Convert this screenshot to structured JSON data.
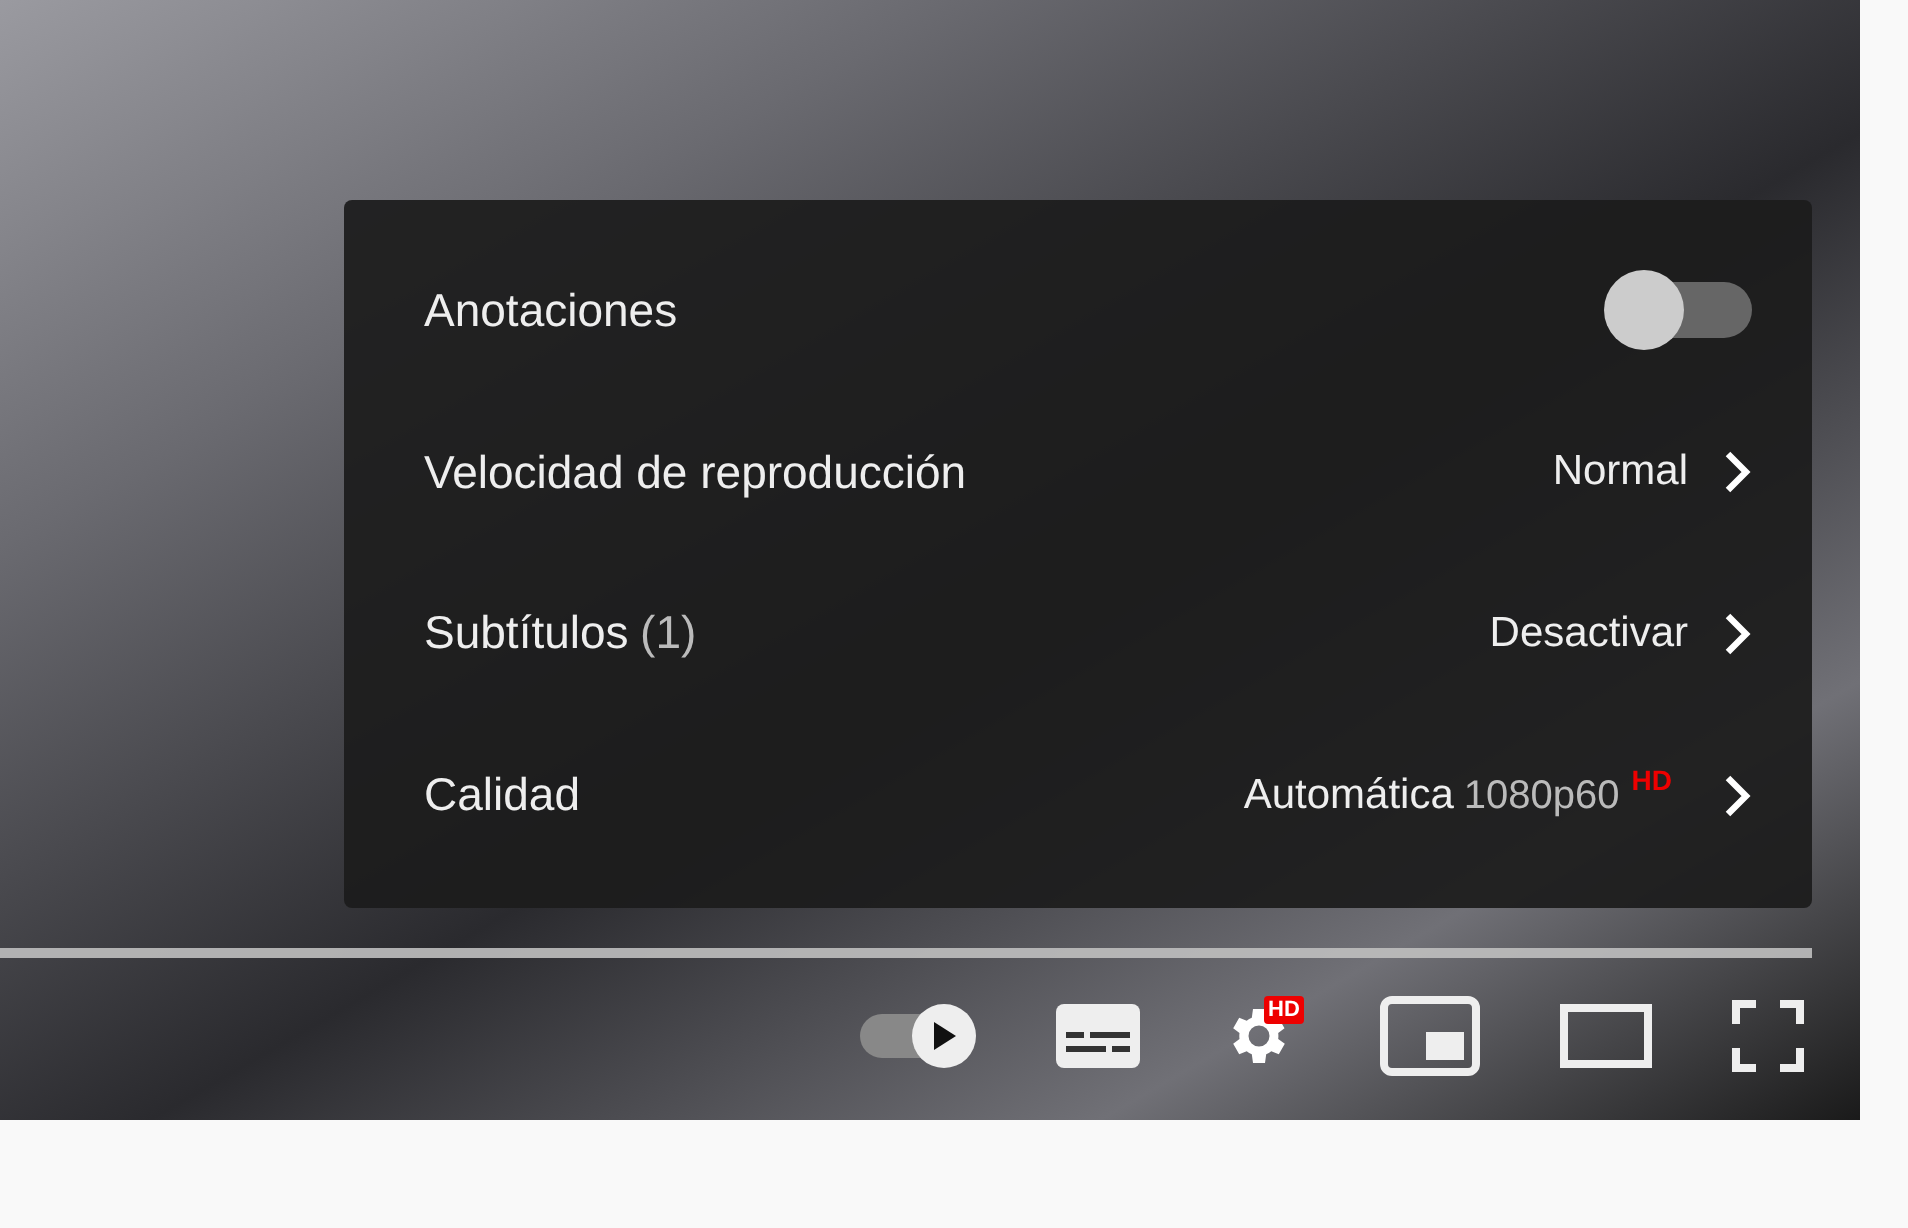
{
  "settings_menu": {
    "items": [
      {
        "kind": "toggle",
        "label": "Anotaciones",
        "on": false
      },
      {
        "kind": "submenu",
        "label": "Velocidad de reproducción",
        "value": "Normal"
      },
      {
        "kind": "submenu",
        "label": "Subtítulos",
        "count": "(1)",
        "value": "Desactivar"
      },
      {
        "kind": "submenu",
        "label": "Calidad",
        "value": "Automática",
        "detail": "1080p60",
        "badge": "HD"
      }
    ]
  },
  "player_controls": {
    "progress": {
      "level": 1
    },
    "autoplay_on": true,
    "settings_badge": "HD"
  }
}
